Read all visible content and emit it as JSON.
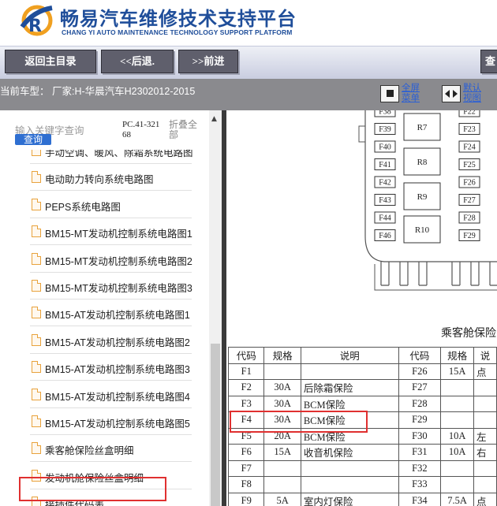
{
  "header": {
    "title": "畅易汽车维修技术支持平台",
    "subtitle": "CHANG YI AUTO MAINTENANCE TECHNOLOGY SUPPORT PLATFORM",
    "brand_color": "#1f4e9a"
  },
  "toolbar": {
    "home_label": "返回主目录",
    "back_label": "<<后退.",
    "forward_label": ">>前进",
    "check_label": "查"
  },
  "model_bar": {
    "current_model": "当前车型：  厂家:H-华晨汽车H2302012-2015",
    "fullscreen_label": "全屏\n菜单",
    "default_view_label": "默认\n视图"
  },
  "left_panel": {
    "search_placeholder": "输入关键字查询",
    "search_button": "查询",
    "pc_code": "PC.41-32168",
    "fold_all": "折叠全部",
    "tree_items": [
      "手动空调、暖风、除霜系统电路图",
      "电动助力转向系统电路图",
      "PEPS系统电路图",
      "BM15-MT发动机控制系统电路图1",
      "BM15-MT发动机控制系统电路图2",
      "BM15-MT发动机控制系统电路图3",
      "BM15-AT发动机控制系统电路图1",
      "BM15-AT发动机控制系统电路图2",
      "BM15-AT发动机控制系统电路图3",
      "BM15-AT发动机控制系统电路图4",
      "BM15-AT发动机控制系统电路图5",
      "乘客舱保险丝盒明细",
      "发动机舱保险丝盒明细",
      "接插件代码表"
    ],
    "selected_item": "乘客舱保险丝盒明细"
  },
  "diagram": {
    "fuse_labels_left": [
      "F38",
      "F39",
      "F40",
      "F41",
      "F42",
      "F43",
      "F44",
      "F46"
    ],
    "relay_labels": [
      "R7",
      "R8",
      "R9",
      "R10"
    ],
    "fuse_labels_right": [
      "F22",
      "F23",
      "F24",
      "F25",
      "F26",
      "F27",
      "F28",
      "F29"
    ],
    "caption": "乘客舱保险"
  },
  "fuse_table": {
    "headers": [
      "代码",
      "规格",
      "说明",
      "代码",
      "规格",
      "说"
    ],
    "rows": [
      [
        "F1",
        "",
        "",
        "F26",
        "15A",
        "点"
      ],
      [
        "F2",
        "30A",
        "后除霜保险",
        "F27",
        "",
        ""
      ],
      [
        "F3",
        "30A",
        "BCM保险",
        "F28",
        "",
        ""
      ],
      [
        "F4",
        "30A",
        "BCM保险",
        "F29",
        "",
        ""
      ],
      [
        "F5",
        "20A",
        "BCM保险",
        "F30",
        "10A",
        "左"
      ],
      [
        "F6",
        "15A",
        "收音机保险",
        "F31",
        "10A",
        "右"
      ],
      [
        "F7",
        "",
        "",
        "F32",
        "",
        ""
      ],
      [
        "F8",
        "",
        "",
        "F33",
        "",
        ""
      ],
      [
        "F9",
        "5A",
        "室内灯保险",
        "F34",
        "7.5A",
        "点"
      ]
    ],
    "highlighted_row": "F4",
    "highlight_color": "#e03030"
  }
}
